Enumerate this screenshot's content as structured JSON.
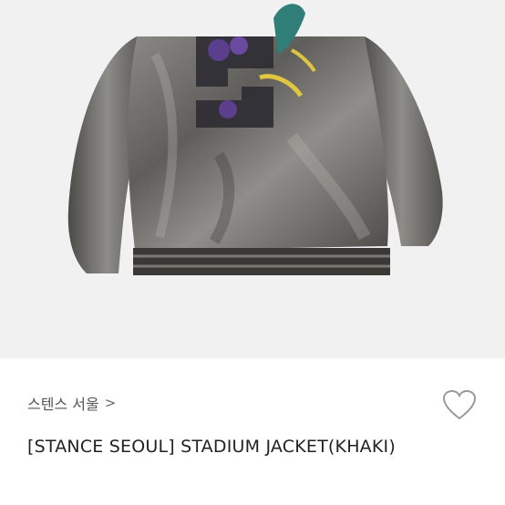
{
  "product": {
    "brand_link": "스텐스 서울",
    "brand_chevron": ">",
    "title": "[STANCE SEOUL] STADIUM JACKET(KHAKI)"
  },
  "icons": {
    "wishlist": "heart-outline-icon",
    "brand_arrow": "chevron-right-icon"
  },
  "colors": {
    "photo_background": "#f1f1f1",
    "jacket": "#6b6a66",
    "title_text": "#222222",
    "brand_text": "#555555"
  }
}
